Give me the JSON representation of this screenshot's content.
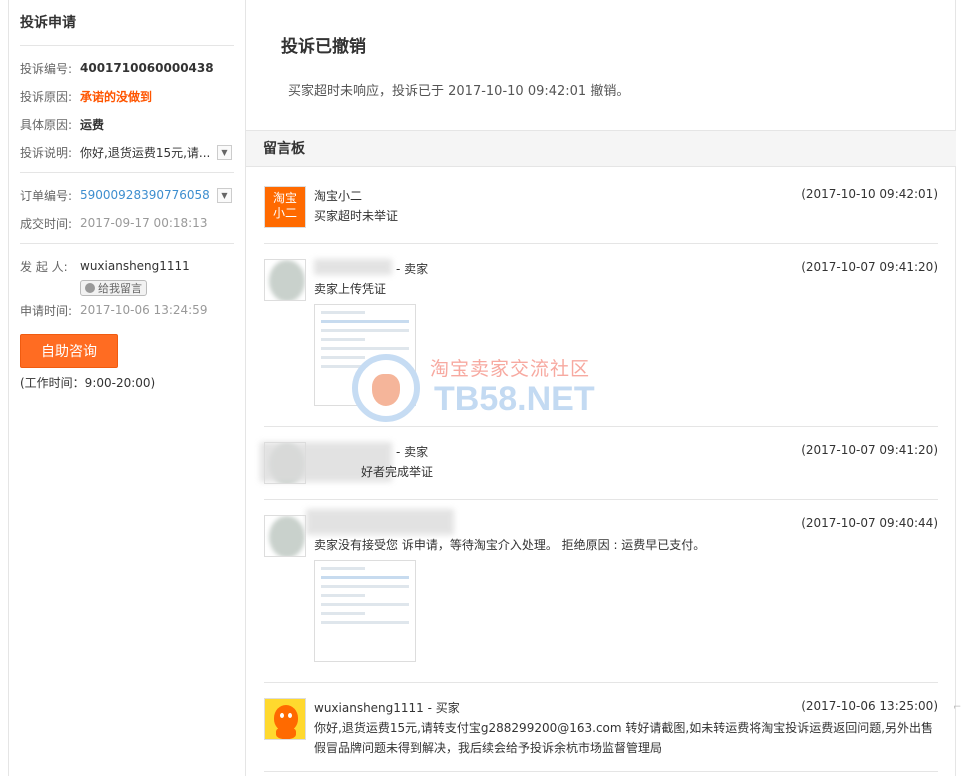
{
  "sidebar": {
    "title": "投诉申请",
    "complaint_no_label": "投诉编号:",
    "complaint_no": "4001710060000438",
    "reason_label": "投诉原因:",
    "reason": "承诺的没做到",
    "detail_reason_label": "具体原因:",
    "detail_reason": "运费",
    "desc_label": "投诉说明:",
    "desc": "你好,退货运费15元,请...",
    "order_no_label": "订单编号:",
    "order_no": "59000928390776058",
    "deal_time_label": "成交时间:",
    "deal_time": "2017-09-17 00:18:13",
    "initiator_label": "发 起 人:",
    "initiator": "wuxiansheng1111",
    "leave_msg_button": "给我留言",
    "apply_time_label": "申请时间:",
    "apply_time": "2017-10-06 13:24:59",
    "consult_button": "自助咨询",
    "work_time": "(工作时间：9:00-20:00)"
  },
  "main": {
    "status_title": "投诉已撤销",
    "status_desc": "买家超时未响应，投诉已于 2017-10-10 09:42:01 撤销。",
    "board_title": "留言板"
  },
  "messages": [
    {
      "avatar_text": "淘宝\n小二",
      "name": "淘宝小二",
      "time": "(2017-10-10 09:42:01)",
      "text": "买家超时未举证"
    },
    {
      "name": "- 卖家",
      "time": "(2017-10-07 09:41:20)",
      "text": "卖家上传凭证"
    },
    {
      "name": "- 卖家",
      "time": "(2017-10-07 09:41:20)",
      "text": "好者完成举证"
    },
    {
      "name": "",
      "time": "(2017-10-07 09:40:44)",
      "text": "卖家没有接受您    诉申请，等待淘宝介入处理。 拒绝原因 : 运费早已支付。"
    },
    {
      "name": "wuxiansheng1111 - 买家",
      "time": "(2017-10-06 13:25:00)",
      "text": "你好,退货运费15元,请转支付宝g288299200@163.com 转好请截图,如未转运费将淘宝投诉运费返回问题,另外出售假冒品牌问题未得到解决，我后续会给予投诉余杭市场监督管理局"
    }
  ],
  "watermark": {
    "line1": "淘宝卖家交流社区",
    "line2": "TB58.NET"
  }
}
